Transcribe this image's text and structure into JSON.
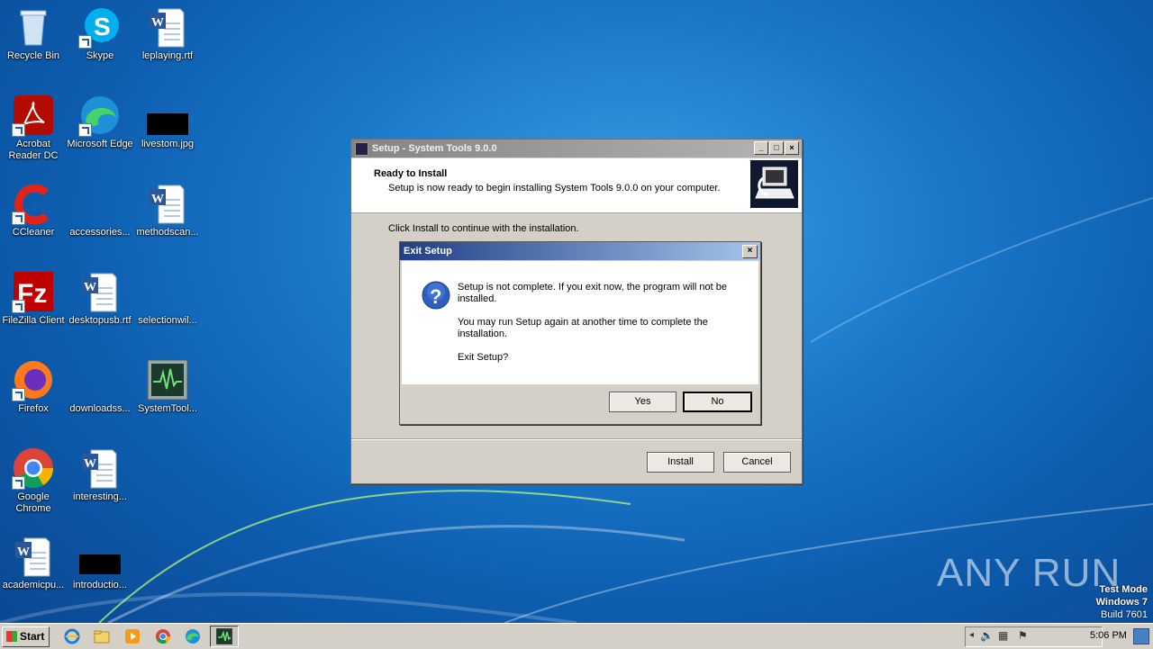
{
  "desktop": {
    "icons": [
      {
        "label": "Recycle Bin"
      },
      {
        "label": "Skype"
      },
      {
        "label": "leplaying.rtf"
      },
      {
        "label": "Acrobat Reader DC"
      },
      {
        "label": "Microsoft Edge"
      },
      {
        "label": "livestom.jpg"
      },
      {
        "label": "CCleaner"
      },
      {
        "label": "accessories..."
      },
      {
        "label": "methodscan..."
      },
      {
        "label": "FileZilla Client"
      },
      {
        "label": "desktopusb.rtf"
      },
      {
        "label": "selectionwil..."
      },
      {
        "label": "Firefox"
      },
      {
        "label": "downloadss..."
      },
      {
        "label": "SystemTool..."
      },
      {
        "label": "Google Chrome"
      },
      {
        "label": "interesting..."
      },
      {
        "label": "academicpu..."
      },
      {
        "label": "introductio..."
      }
    ]
  },
  "setup_window": {
    "title": "Setup - System Tools 9.0.0",
    "header_title": "Ready to Install",
    "header_subtitle": "Setup is now ready to begin installing System Tools 9.0.0 on your computer.",
    "body_text": "Click Install to continue with the installation.",
    "install_label": "Install",
    "cancel_label": "Cancel"
  },
  "exit_dialog": {
    "title": "Exit Setup",
    "message1": "Setup is not complete. If you exit now, the program will not be installed.",
    "message2": "You may run Setup again at another time to complete the installation.",
    "message3": "Exit Setup?",
    "yes_label": "Yes",
    "no_label": "No"
  },
  "taskbar": {
    "start_label": "Start",
    "clock": "5:06 PM"
  },
  "watermark": {
    "line1": "Test Mode",
    "line2": "Windows 7",
    "line3": "Build 7601",
    "brand": "ANY RUN"
  }
}
